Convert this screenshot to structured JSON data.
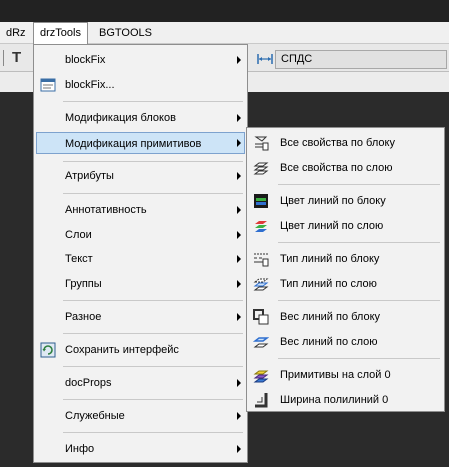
{
  "menubar": {
    "items": [
      "dRz",
      "drzTools",
      "BGTOOLS"
    ]
  },
  "toolbar": {
    "left_glyph": "T",
    "field_value": "СПДС"
  },
  "main_menu": {
    "items": [
      {
        "label": "blockFix",
        "has_submenu": true,
        "icon": "none"
      },
      {
        "label": "blockFix...",
        "has_submenu": false,
        "icon": "window-dialog-icon"
      },
      {
        "label": "Модификация блоков",
        "has_submenu": true,
        "icon": "none"
      },
      {
        "label": "Модификация примитивов",
        "has_submenu": true,
        "icon": "none",
        "highlighted": true
      },
      {
        "label": "Атрибуты",
        "has_submenu": true,
        "icon": "none"
      },
      {
        "label": "Аннотативность",
        "has_submenu": true,
        "icon": "none"
      },
      {
        "label": "Слои",
        "has_submenu": true,
        "icon": "none"
      },
      {
        "label": "Текст",
        "has_submenu": true,
        "icon": "none"
      },
      {
        "label": "Группы",
        "has_submenu": true,
        "icon": "none"
      },
      {
        "label": "Разное",
        "has_submenu": true,
        "icon": "none"
      },
      {
        "label": "Сохранить интерфейс",
        "has_submenu": false,
        "icon": "save-interface-icon"
      },
      {
        "label": "docProps",
        "has_submenu": true,
        "icon": "none"
      },
      {
        "label": "Служебные",
        "has_submenu": true,
        "icon": "none"
      },
      {
        "label": "Инфо",
        "has_submenu": true,
        "icon": "none"
      }
    ]
  },
  "submenu": {
    "items": [
      {
        "label": "Все свойства по блоку",
        "icon": "all-props-by-block-icon"
      },
      {
        "label": "Все свойства по слою",
        "icon": "all-props-by-layer-icon"
      },
      {
        "label": "Цвет линий по блоку",
        "icon": "color-by-block-icon"
      },
      {
        "label": "Цвет линий по слою",
        "icon": "color-by-layer-icon"
      },
      {
        "label": "Тип линий по блоку",
        "icon": "linetype-by-block-icon"
      },
      {
        "label": "Тип линий по слою",
        "icon": "linetype-by-layer-icon"
      },
      {
        "label": "Вес линий по блоку",
        "icon": "lineweight-by-block-icon"
      },
      {
        "label": "Вес линий по слою",
        "icon": "lineweight-by-layer-icon"
      },
      {
        "label": "Примитивы на слой 0",
        "icon": "entities-to-layer0-icon"
      },
      {
        "label": "Ширина полилиний 0",
        "icon": "polyline-width-zero-icon"
      }
    ]
  },
  "colors": {
    "highlight": "#cde4f7",
    "highlight_border": "#7da2ce",
    "menu_bg": "#f2f2f2"
  }
}
